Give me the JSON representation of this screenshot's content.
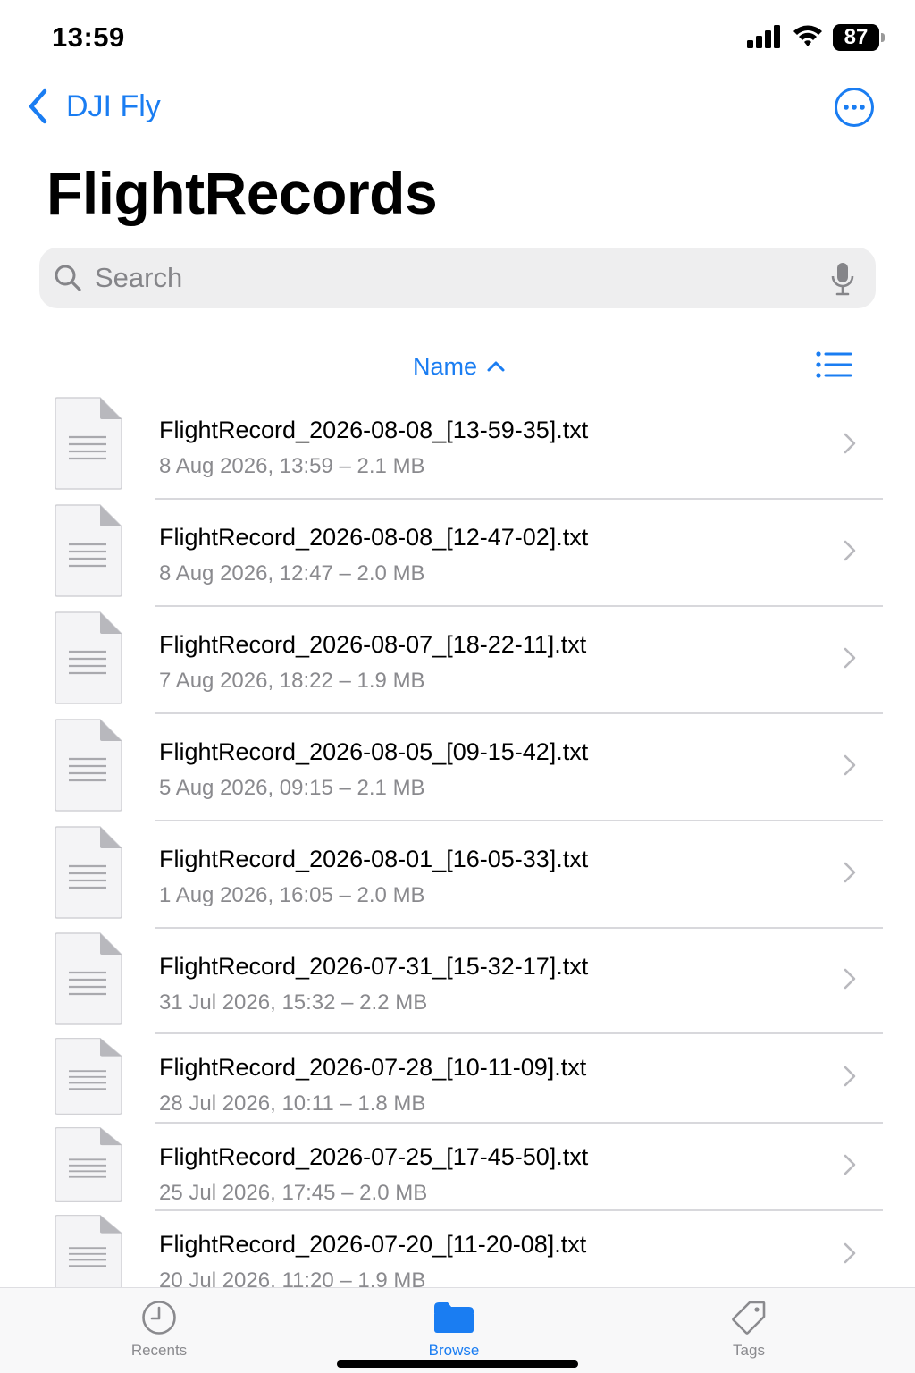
{
  "status_bar": {
    "time": "13:59",
    "battery": "87"
  },
  "nav": {
    "back_label": "DJI Fly",
    "more_icon": "ellipsis-circle-icon"
  },
  "title": "FlightRecords",
  "search": {
    "placeholder": "Search",
    "value": ""
  },
  "sort": {
    "label": "Name",
    "direction_icon": "chevron-up-icon"
  },
  "colors": {
    "accent": "#1a7df2",
    "secondary_text": "#8a8a8e",
    "search_bg": "#eeeeef"
  },
  "files": [
    {
      "name": "FlightRecord_2026-08-08_[13-59-35].txt",
      "meta": "8 Aug 2026, 13:59 – 2.1 MB"
    },
    {
      "name": "FlightRecord_2026-08-08_[12-47-02].txt",
      "meta": "8 Aug 2026, 12:47 – 2.0 MB"
    },
    {
      "name": "FlightRecord_2026-08-07_[18-22-11].txt",
      "meta": "7 Aug 2026, 18:22 – 1.9 MB"
    },
    {
      "name": "FlightRecord_2026-08-05_[09-15-42].txt",
      "meta": "5 Aug 2026, 09:15 – 2.1 MB"
    },
    {
      "name": "FlightRecord_2026-08-01_[16-05-33].txt",
      "meta": "1 Aug 2026, 16:05 – 2.0 MB"
    },
    {
      "name": "FlightRecord_2026-07-31_[15-32-17].txt",
      "meta": "31 Jul 2026, 15:32 – 2.2 MB"
    },
    {
      "name": "FlightRecord_2026-07-28_[10-11-09].txt",
      "meta": "28 Jul 2026, 10:11 – 1.8 MB"
    },
    {
      "name": "FlightRecord_2026-07-25_[17-45-50].txt",
      "meta": "25 Jul 2026, 17:45 – 2.0 MB"
    },
    {
      "name": "FlightRecord_2026-07-20_[11-20-08].txt",
      "meta": "20 Jul 2026, 11:20 – 1.9 MB"
    }
  ],
  "tabs": [
    {
      "label": "Recents",
      "icon": "clock-icon",
      "active": false
    },
    {
      "label": "Browse",
      "icon": "folder-icon",
      "active": true
    },
    {
      "label": "Tags",
      "icon": "tag-icon",
      "active": false
    }
  ]
}
